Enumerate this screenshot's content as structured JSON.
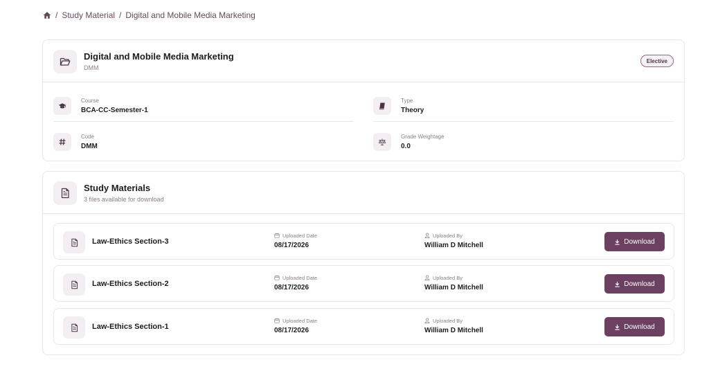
{
  "breadcrumb": {
    "home_icon": "home-icon",
    "separator": "/",
    "items": [
      "Study Material",
      "Digital and Mobile Media Marketing"
    ]
  },
  "subject": {
    "icon": "folder-open-icon",
    "title": "Digital and Mobile Media Marketing",
    "code_short": "DMM",
    "badge": "Elective",
    "details": [
      {
        "icon": "graduation-cap-icon",
        "label": "Course",
        "value": "BCA-CC-Semester-1"
      },
      {
        "icon": "book-icon",
        "label": "Type",
        "value": "Theory"
      },
      {
        "icon": "hash-icon",
        "label": "Code",
        "value": "DMM"
      },
      {
        "icon": "scale-icon",
        "label": "Grade Weightage",
        "value": "0.0"
      }
    ]
  },
  "materials": {
    "icon": "document-icon",
    "title": "Study Materials",
    "subtitle": "3 files available for download",
    "date_label": "Uploaded Date",
    "by_label": "Uploaded By",
    "download_label": "Download",
    "items": [
      {
        "title": "Law-Ethics Section-3",
        "date": "08/17/2026",
        "uploader": "William D Mitchell"
      },
      {
        "title": "Law-Ethics Section-2",
        "date": "08/17/2026",
        "uploader": "William D Mitchell"
      },
      {
        "title": "Law-Ethics Section-1",
        "date": "08/17/2026",
        "uploader": "William D Mitchell"
      }
    ]
  },
  "colors": {
    "accent": "#6b4060",
    "icon_bg": "#f3eef2",
    "border": "#ebe6ea",
    "muted_text": "#8a7f87"
  }
}
